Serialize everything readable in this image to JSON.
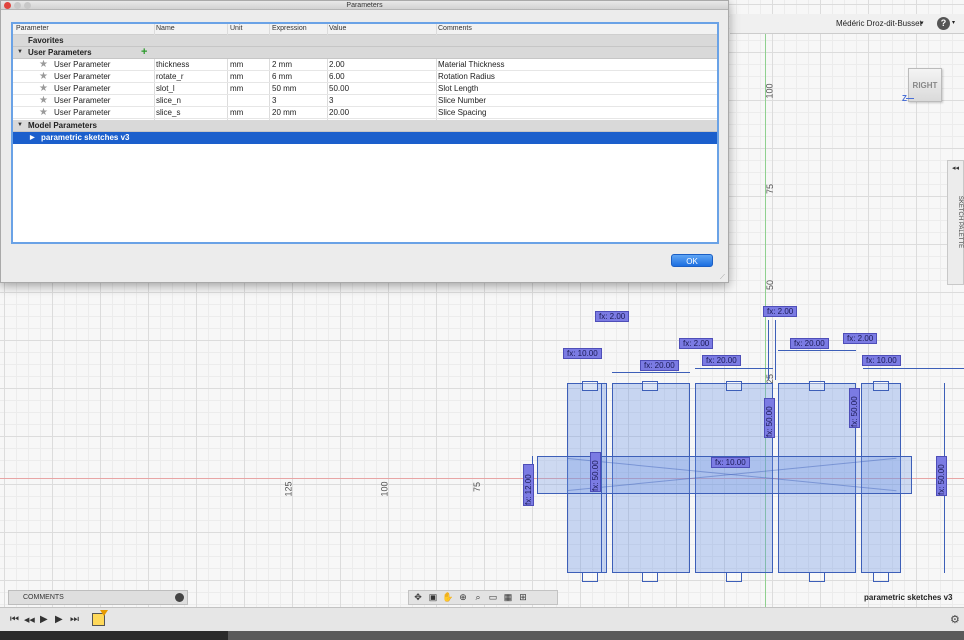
{
  "dialog": {
    "title": "Parameters",
    "ok_label": "OK",
    "columns": [
      "Parameter",
      "Name",
      "Unit",
      "Expression",
      "Value",
      "Comments"
    ],
    "groups": {
      "favorites": "Favorites",
      "user": "User Parameters",
      "model": "Model Parameters"
    },
    "user_params": [
      {
        "type": "User Parameter",
        "name": "thickness",
        "unit": "mm",
        "expression": "2 mm",
        "value": "2.00",
        "comment": "Material Thickness"
      },
      {
        "type": "User Parameter",
        "name": "rotate_r",
        "unit": "mm",
        "expression": "6 mm",
        "value": "6.00",
        "comment": "Rotation Radius"
      },
      {
        "type": "User Parameter",
        "name": "slot_l",
        "unit": "mm",
        "expression": "50 mm",
        "value": "50.00",
        "comment": "Slot Length"
      },
      {
        "type": "User Parameter",
        "name": "slice_n",
        "unit": "",
        "expression": "3",
        "value": "3",
        "comment": "Slice Number"
      },
      {
        "type": "User Parameter",
        "name": "slice_s",
        "unit": "mm",
        "expression": "20 mm",
        "value": "20.00",
        "comment": "Slice Spacing"
      }
    ],
    "model_item": "parametric sketches v3"
  },
  "topbar": {
    "user_name": "Médéric Droz-dit-Busset",
    "user_caret": "▾",
    "help": "?",
    "help_caret": "▾"
  },
  "viewcube": {
    "face": "RIGHT",
    "axis": "Z"
  },
  "palette": {
    "label": "SKETCH PALETTE",
    "collapse": "◂◂"
  },
  "rulers": {
    "top_100": "100",
    "v75": "75",
    "v50": "50",
    "v25": "25",
    "h125": "125",
    "h100": "100",
    "h75": "75"
  },
  "dimensions": {
    "d_2a": "fx: 2.00",
    "d_10a": "fx: 10.00",
    "d_2b": "fx: 2.00",
    "d_20a": "fx: 20.00",
    "d_20b": "fx: 20.00",
    "d_2c": "fx: 2.00",
    "d_20c": "fx: 20.00",
    "d_2d": "fx: 2.00",
    "d_10b": "fx: 10.00",
    "d_10c": "fx: 10.00",
    "v_12": "fx: 12.00",
    "v_50a": "fx: 50.00",
    "v_50b": "fx: 50.00",
    "v_50c": "fx: 50.00",
    "v_50d": "fx: 50.00"
  },
  "bottom": {
    "comments_label": "COMMENTS",
    "document_name": "parametric sketches v3",
    "nav_icons": [
      "orbit-icon",
      "look-icon",
      "pan-icon",
      "zoom-window-icon",
      "zoom-icon",
      "display-icon",
      "grid-icon",
      "viewports-icon"
    ],
    "timeline_controls": [
      "⏮",
      "◀◀",
      "▶",
      "▶",
      "⏭"
    ]
  },
  "colors": {
    "sketch_fill": "#6e96e6",
    "sketch_line": "#3d5fb8",
    "dimension_fill": "#7b7be3",
    "selection": "#1b5fcc",
    "ok_button": "#1c6fe0"
  }
}
